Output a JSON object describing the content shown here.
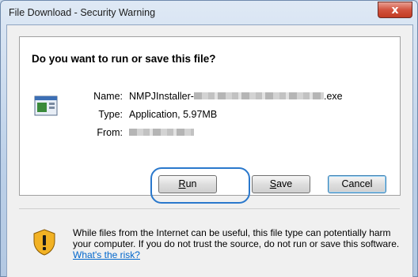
{
  "window": {
    "title": "File Download - Security Warning",
    "close_glyph": "x"
  },
  "dialog": {
    "question": "Do you want to run or save this file?",
    "icon": "application-exe-icon",
    "fields": {
      "name_label": "Name:",
      "name_prefix": "NMPJInstaller-",
      "name_suffix": ".exe",
      "type_label": "Type:",
      "type_value": "Application, 5.97MB",
      "from_label": "From:"
    },
    "buttons": {
      "run": {
        "accel": "R",
        "rest": "un"
      },
      "save": {
        "accel": "S",
        "rest": "ave"
      },
      "cancel": "Cancel"
    },
    "warning": {
      "icon": "shield-warning-icon",
      "text": "While files from the Internet can be useful, this file type can potentially harm your computer. If you do not trust the source, do not run or save this software. ",
      "link": "What's the risk?"
    }
  },
  "colors": {
    "highlight_ring": "#2a78cc",
    "link": "#0066cc",
    "close_button": "#c23b23"
  }
}
